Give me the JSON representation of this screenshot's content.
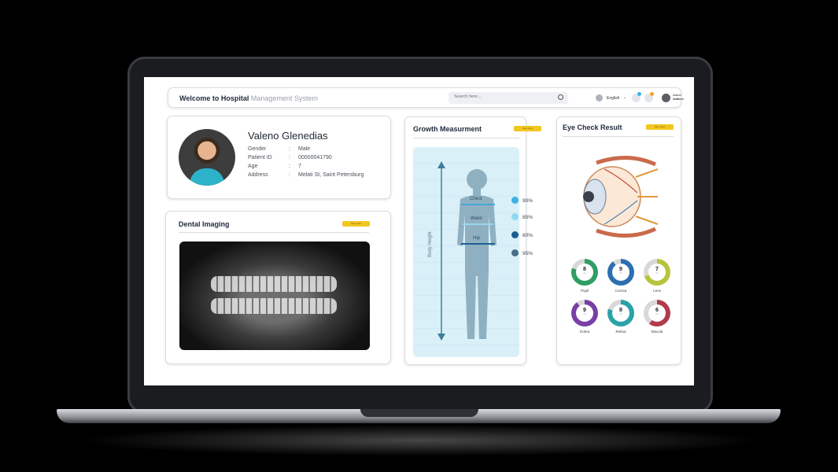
{
  "header": {
    "title_bold": "Welcome to Hospital",
    "title_light": "Management System",
    "search_placeholder": "Search here...",
    "language": "English",
    "user_name": "Aaron Sullivan",
    "user_role": "Admin"
  },
  "patient": {
    "name": "Valeno Glenedias",
    "fields": [
      {
        "label": "Gender",
        "value": "Male"
      },
      {
        "label": "Patient ID",
        "value": "00000041790"
      },
      {
        "label": "Age",
        "value": "7"
      },
      {
        "label": "Address",
        "value": "Melati St, Saint Petersburg"
      }
    ]
  },
  "dental": {
    "title": "Dental Imaging",
    "button_label": "See more"
  },
  "growth": {
    "title": "Growth Measurment",
    "button_label": "See more",
    "axis_label": "Body Height",
    "measures": [
      {
        "label": "Chest",
        "color": "#4aa6d9"
      },
      {
        "label": "Waist",
        "color": "#9ad7f0"
      },
      {
        "label": "Hip",
        "color": "#1e5f8f"
      }
    ],
    "legend": [
      {
        "value": "90%",
        "color": "#3fb0e4"
      },
      {
        "value": "85%",
        "color": "#8fd8f5"
      },
      {
        "value": "80%",
        "color": "#1a5f93"
      },
      {
        "value": "95%",
        "color": "#4a6f86"
      }
    ]
  },
  "eye": {
    "title": "Eye Check Result",
    "button_label": "See more",
    "metrics": [
      {
        "label": "Pupil",
        "value": "8",
        "sub": "/10",
        "score": 0.8,
        "color": "#2f9e63"
      },
      {
        "label": "Cornea",
        "value": "9",
        "sub": "/10",
        "score": 0.9,
        "color": "#2d6fb0"
      },
      {
        "label": "Lens",
        "value": "7",
        "sub": "/10",
        "score": 0.7,
        "color": "#b6c43c"
      },
      {
        "label": "Sclera",
        "value": "9",
        "sub": "/10",
        "score": 0.9,
        "color": "#7a3fa6"
      },
      {
        "label": "Retina",
        "value": "8",
        "sub": "/10",
        "score": 0.8,
        "color": "#2aa2a8"
      },
      {
        "label": "Macula",
        "value": "6",
        "sub": "/10",
        "score": 0.6,
        "color": "#b23a4c"
      }
    ]
  }
}
